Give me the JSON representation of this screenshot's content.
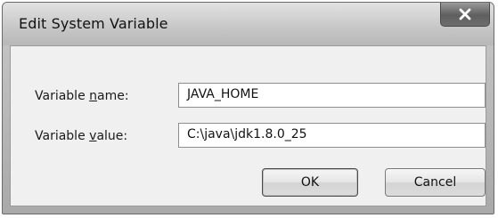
{
  "window": {
    "title": "Edit System Variable",
    "close_icon": "close-icon"
  },
  "form": {
    "name_label_pre": "Variable ",
    "name_label_accel": "n",
    "name_label_post": "ame:",
    "name_value": "JAVA_HOME",
    "value_label_pre": "Variable ",
    "value_label_accel": "v",
    "value_label_post": "alue:",
    "value_value": "C:\\java\\jdk1.8.0_25"
  },
  "buttons": {
    "ok_label": "OK",
    "cancel_label": "Cancel"
  }
}
